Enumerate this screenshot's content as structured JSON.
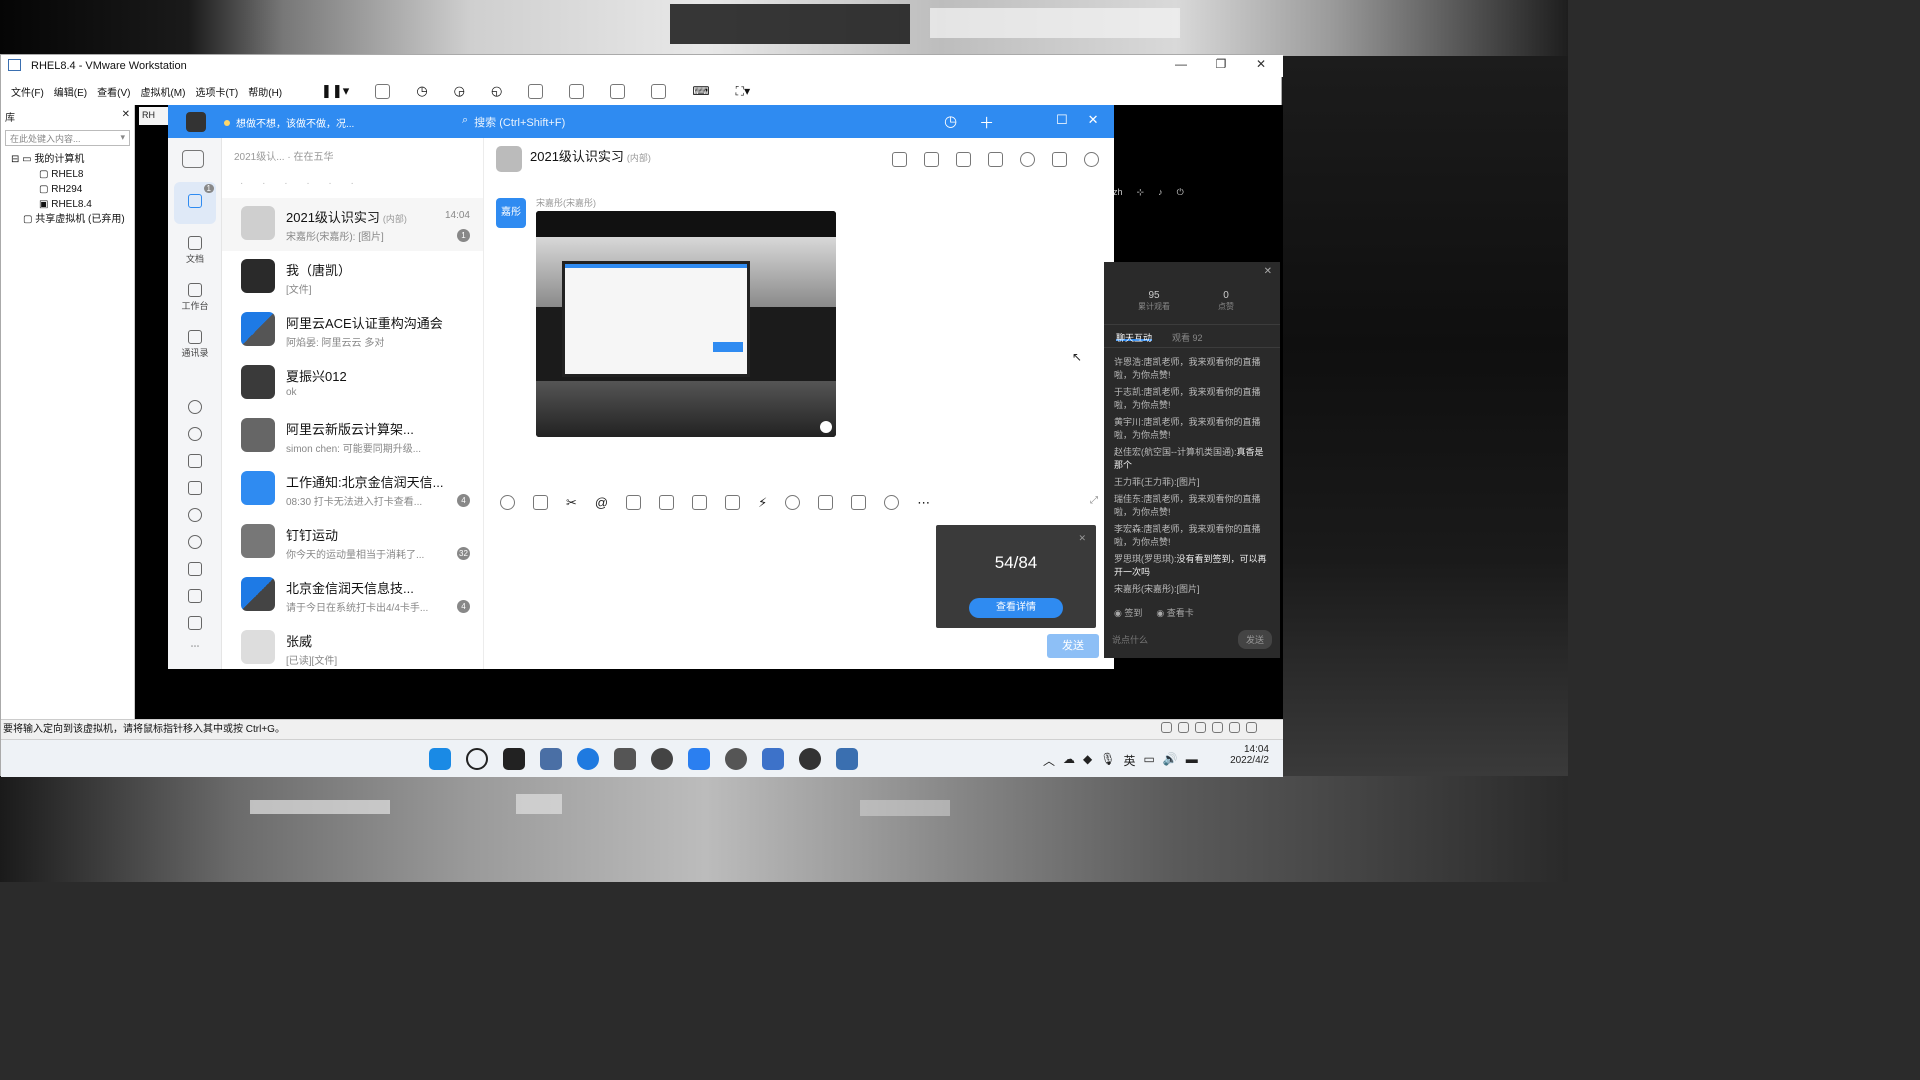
{
  "vmware": {
    "title": "RHEL8.4 - VMware Workstation",
    "menu": [
      "文件(F)",
      "编辑(E)",
      "查看(V)",
      "虚拟机(M)",
      "选项卡(T)",
      "帮助(H)"
    ],
    "library": {
      "header": "库",
      "search_placeholder": "在此处键入内容...",
      "tree": {
        "root": "我的计算机",
        "vms": [
          "RHEL8",
          "RH294",
          "RHEL8.4"
        ],
        "shared": "共享虚拟机 (已弃用)"
      }
    },
    "tab_label": "RH",
    "guest_lang": "zh",
    "status_text": "要将输入定向到该虚拟机，请将鼠标指针移入其中或按 Ctrl+G。"
  },
  "taskbar": {
    "ime": "英",
    "time": "14:04",
    "date": "2022/4/2"
  },
  "dingtalk": {
    "search_placeholder": "搜索 (Ctrl+Shift+F)",
    "user_status": "想做不想，该做不做，况...",
    "list_header": "2021级认... · 在在五华",
    "rail": [
      {
        "label": "",
        "icon": "message-icon"
      },
      {
        "label": "文档",
        "icon": "document-icon"
      },
      {
        "label": "工作台",
        "icon": "workbench-icon"
      },
      {
        "label": "通讯录",
        "icon": "contacts-icon"
      }
    ],
    "conversations": [
      {
        "name": "2021级认识实习",
        "tag": "(内部)",
        "preview": "宋嘉彤(宋嘉彤): [图片]",
        "time": "14:04",
        "badge": "1"
      },
      {
        "name": "我（唐凯）",
        "tag": "",
        "preview": "[文件]",
        "time": "",
        "badge": ""
      },
      {
        "name": "阿里云ACE认证重构沟通会",
        "tag": "",
        "preview": "阿焰晏: 阿里云云 多对",
        "time": "",
        "badge": ""
      },
      {
        "name": "夏振兴012",
        "tag": "",
        "preview": "ok",
        "time": "",
        "badge": ""
      },
      {
        "name": "阿里云新版云计算架...",
        "tag": "",
        "preview": "simon chen: 可能要同期升级...",
        "time": "",
        "badge": ""
      },
      {
        "name": "工作通知:北京金信润天信...",
        "tag": "",
        "preview": "08:30 打卡无法进入打卡查看...",
        "time": "",
        "badge": "4"
      },
      {
        "name": "钉钉运动",
        "tag": "",
        "preview": "你今天的运动量相当于消耗了...",
        "time": "",
        "badge": "32"
      },
      {
        "name": "北京金信润天信息技...",
        "tag": "",
        "preview": "请于今日在系统打卡出4/4卡手...",
        "time": "",
        "badge": "4"
      },
      {
        "name": "张威",
        "tag": "",
        "preview": "[已读][文件]",
        "time": "",
        "badge": ""
      }
    ],
    "chat": {
      "title": "2021级认识实习",
      "title_tag": "(内部)",
      "sender_avatar_text": "嘉彤",
      "sender_name": "宋嘉彤(宋嘉彤)",
      "send_button": "发送"
    },
    "signin_popup": {
      "count": "54/84",
      "button": "查看详情"
    }
  },
  "live_panel": {
    "stats": [
      {
        "value": "95",
        "label": "累计观看"
      },
      {
        "value": "0",
        "label": "点赞"
      }
    ],
    "tabs": [
      "聊天互动",
      "观看 92"
    ],
    "messages": [
      {
        "user": "许恩浩:",
        "text": "唐凯老师，我来观看你的直播啦，为你点赞!"
      },
      {
        "user": "于志凯:",
        "text": "唐凯老师，我来观看你的直播啦，为你点赞!"
      },
      {
        "user": "黄宇川:",
        "text": "唐凯老师，我来观看你的直播啦，为你点赞!"
      },
      {
        "user": "赵佳宏(航空国--计算机类国通):",
        "text": "真香是那个"
      },
      {
        "user": "王力菲(王力菲):",
        "text": "[图片]"
      },
      {
        "user": "瑞佳东:",
        "text": "唐凯老师，我来观看你的直播啦，为你点赞!"
      },
      {
        "user": "李宏森:",
        "text": "唐凯老师，我来观看你的直播啦，为你点赞!"
      },
      {
        "user": "罗思琪(罗思琪):",
        "text": "没有看到签到，可以再开一次吗"
      },
      {
        "user": "宋嘉彤(宋嘉彤):",
        "text": "[图片]"
      }
    ],
    "options": [
      "签到",
      "查看卡"
    ],
    "input_placeholder": "说点什么",
    "send": "发送"
  },
  "colors": {
    "dingtalk_blue": "#2f8bf1",
    "live_bg": "#2a2a2a"
  }
}
